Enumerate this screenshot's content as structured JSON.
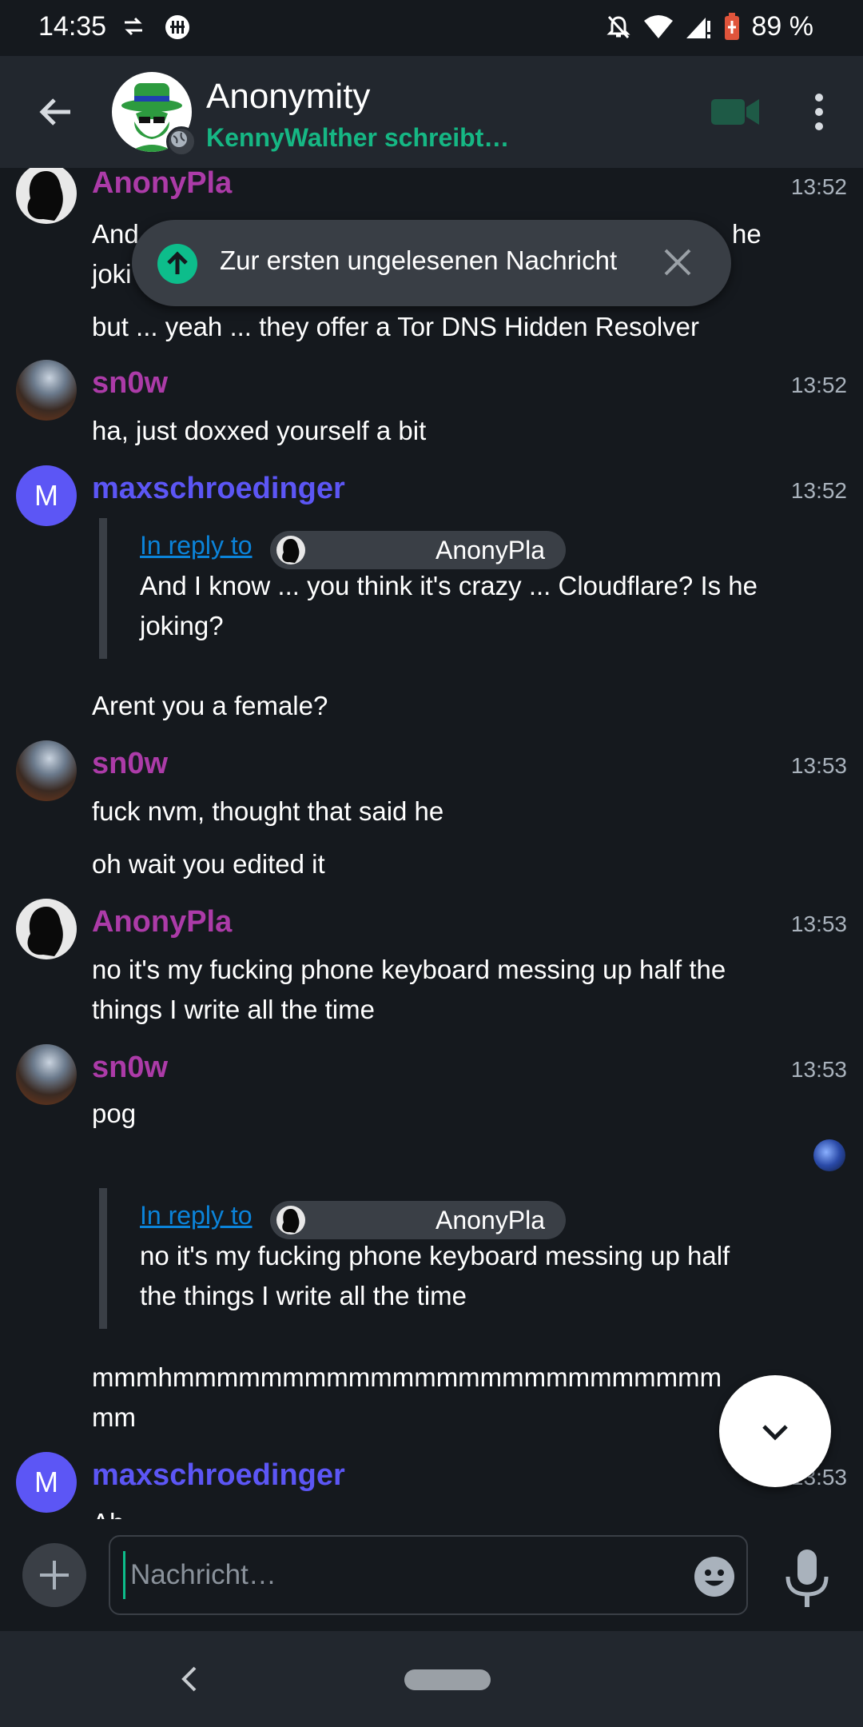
{
  "status_bar": {
    "time": "14:35",
    "battery": "89 %"
  },
  "header": {
    "room_name": "Anonymity",
    "typing_status": "KennyWalther schreibt…"
  },
  "toast": {
    "label": "Zur ersten ungelesenen Nachricht"
  },
  "timeline": {
    "partial_top": {
      "sender": "AnonyPla",
      "timestamp": "13:52",
      "line1_left": "And",
      "line1_right": "he",
      "line2_left": "joki",
      "line3": "but ... yeah ... they offer a Tor DNS Hidden Resolver"
    },
    "msg_snow_1": {
      "sender": "sn0w",
      "timestamp": "13:52",
      "text": "ha, just doxxed yourself a bit"
    },
    "msg_max_1": {
      "avatar_letter": "M",
      "sender": "maxschroedinger",
      "timestamp": "13:52",
      "reply_link": "In reply to",
      "reply_to": "AnonyPla",
      "reply_text": "And I know ... you think it's crazy ... Cloudflare? Is he joking?",
      "text": "Arent you a female?"
    },
    "msg_snow_2": {
      "sender": "sn0w",
      "timestamp": "13:53",
      "text1": "fuck nvm, thought that said he",
      "text2": "oh wait you edited it"
    },
    "msg_anony_2": {
      "sender": "AnonyPla",
      "timestamp": "13:53",
      "text": "no it's my fucking phone keyboard messing up half the things I write all the time"
    },
    "msg_snow_3": {
      "sender": "sn0w",
      "timestamp": "13:53",
      "text": "pog",
      "reply_link": "In reply to",
      "reply_to": "AnonyPla",
      "reply_text": "no it's my fucking phone keyboard messing up half the things I write all the time",
      "text2_line1": "mmmhmmmmmmmmmmmmmmmmmmmmmmmmm",
      "text2_line2": "mm"
    },
    "msg_max_2": {
      "avatar_letter": "M",
      "sender": "maxschroedinger",
      "timestamp": "13:53",
      "text_cut": "Ah"
    }
  },
  "composer": {
    "placeholder": "Nachricht…"
  },
  "colors": {
    "accent_green": "#0dbd8b",
    "sender_magenta": "#ac3ba8",
    "sender_blue": "#5c56f5",
    "link_blue": "#0b83d9",
    "background": "#15191e"
  },
  "icons": [
    "back-arrow-icon",
    "video-call-icon",
    "more-vert-icon",
    "arrow-up-icon",
    "close-icon",
    "chevron-down-icon",
    "plus-icon",
    "emoji-icon",
    "microphone-icon",
    "nav-back-icon"
  ]
}
